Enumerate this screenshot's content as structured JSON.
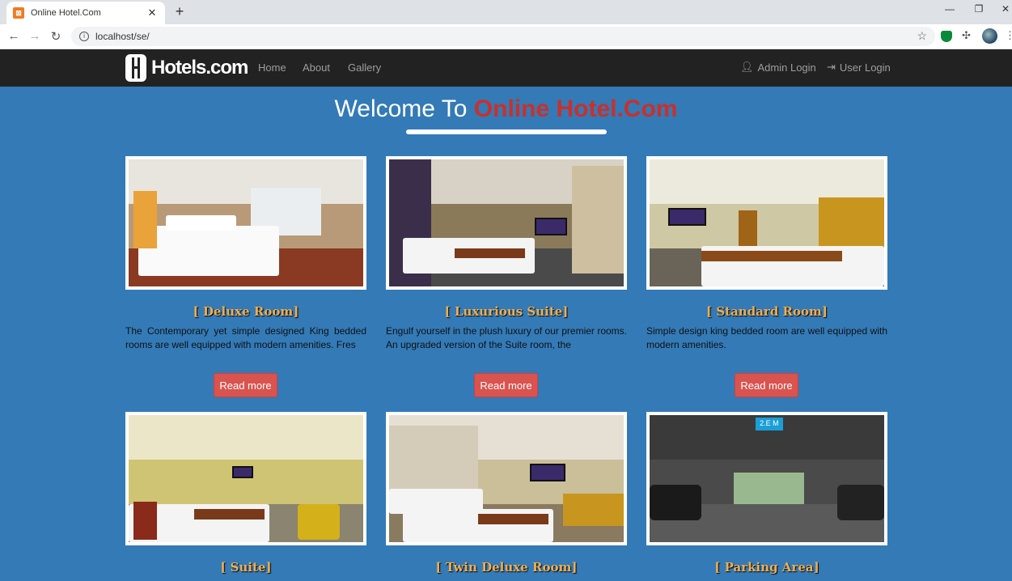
{
  "browser": {
    "tab_title": "Online Hotel.Com",
    "tab_close": "✕",
    "new_tab": "+",
    "url": "localhost/se/",
    "minimize": "—",
    "restore": "❐",
    "close": "✕"
  },
  "navbar": {
    "brand": "Hotels.com",
    "links": [
      "Home",
      "About",
      "Gallery"
    ],
    "admin_login": "Admin Login",
    "user_login": "User Login"
  },
  "heading": {
    "prefix": "Welcome To ",
    "highlight": "Online Hotel.Com"
  },
  "rooms": [
    {
      "title": "[ Deluxe Room]",
      "description": "The Contemporary yet simple designed King bedded rooms are well equipped with modern amenities. Fres",
      "button": "Read more"
    },
    {
      "title": "[ Luxurious Suite]",
      "description": "Engulf yourself in the plush luxury of our premier rooms. An upgraded version of the Suite room, the",
      "button": "Read more"
    },
    {
      "title": "[ Standard Room]",
      "description": "Simple design king bedded room are well equipped with modern amenities.",
      "button": "Read more"
    },
    {
      "title": "[ Suite]"
    },
    {
      "title": "[ Twin Deluxe Room]"
    },
    {
      "title": "[ Parking Area]"
    }
  ],
  "colors": {
    "page_bg": "#337ab7",
    "navbar_bg": "#222222",
    "highlight": "#c9302c",
    "title_gold": "#f0ad4e",
    "button_red": "#d9534f"
  }
}
